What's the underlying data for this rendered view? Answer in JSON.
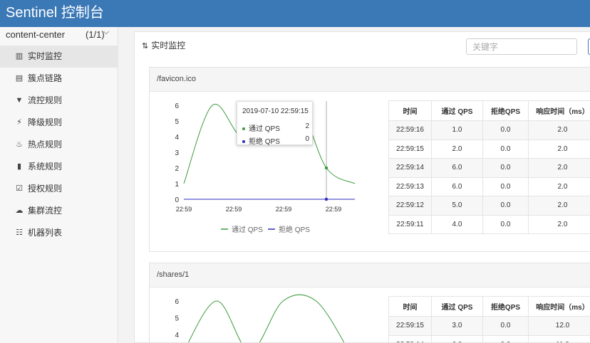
{
  "app": {
    "brand": "Sentinel 控制台"
  },
  "sidebar": {
    "app_name": "content-center",
    "app_count": "(1/1)",
    "items": [
      {
        "label": "实时监控",
        "icon": "bar-chart-icon",
        "active": true
      },
      {
        "label": "簇点链路",
        "icon": "list-icon"
      },
      {
        "label": "流控规则",
        "icon": "filter-icon"
      },
      {
        "label": "降级规则",
        "icon": "bolt-icon"
      },
      {
        "label": "热点规则",
        "icon": "fire-icon"
      },
      {
        "label": "系统规则",
        "icon": "lock-icon"
      },
      {
        "label": "授权规则",
        "icon": "check-icon"
      },
      {
        "label": "集群流控",
        "icon": "cloud-icon"
      },
      {
        "label": "机器列表",
        "icon": "server-list-icon"
      }
    ]
  },
  "main": {
    "title": "实时监控",
    "search_placeholder": "关键字"
  },
  "table_headers": [
    "时间",
    "通过 QPS",
    "拒绝QPS",
    "响应时间（ms）"
  ],
  "panels": [
    {
      "resource": "/favicon.ico",
      "tooltip": {
        "time": "2019-07-10 22:59:15",
        "pass_label": "通过 QPS",
        "pass_value": "2",
        "block_label": "拒绝 QPS",
        "block_value": "0"
      },
      "rows": [
        [
          "22:59:16",
          "1.0",
          "0.0",
          "2.0"
        ],
        [
          "22:59:15",
          "2.0",
          "0.0",
          "2.0"
        ],
        [
          "22:59:14",
          "6.0",
          "0.0",
          "2.0"
        ],
        [
          "22:59:13",
          "6.0",
          "0.0",
          "2.0"
        ],
        [
          "22:59:12",
          "5.0",
          "0.0",
          "2.0"
        ],
        [
          "22:59:11",
          "4.0",
          "0.0",
          "2.0"
        ]
      ]
    },
    {
      "resource": "/shares/1",
      "rows": [
        [
          "22:59:15",
          "3.0",
          "0.0",
          "12.0"
        ],
        [
          "22:59:14",
          "6.0",
          "0.0",
          "11.0"
        ]
      ]
    }
  ],
  "chart_data": [
    {
      "type": "line",
      "x": [
        0,
        1,
        2,
        3,
        4,
        5,
        6
      ],
      "xtick_labels": [
        "22:59",
        "22:59",
        "22:59",
        "22:59"
      ],
      "yticks": [
        0,
        1,
        2,
        3,
        4,
        5,
        6
      ],
      "ylim": [
        0,
        6
      ],
      "legend": "bottom",
      "series": [
        {
          "name": "通过 QPS",
          "color": "#3d9a3d",
          "values": [
            1,
            6,
            4,
            4,
            6,
            2,
            1
          ]
        },
        {
          "name": "拒绝 QPS",
          "color": "#2c2cbf",
          "values": [
            0,
            0,
            0,
            0,
            0,
            0,
            0
          ]
        }
      ]
    },
    {
      "type": "line",
      "x": [
        0,
        1,
        2,
        3,
        4,
        5
      ],
      "yticks": [
        4,
        5,
        6
      ],
      "ylim": [
        0,
        6
      ],
      "series": [
        {
          "name": "通过 QPS",
          "color": "#3d9a3d",
          "values": [
            3,
            6,
            3,
            6,
            6,
            3
          ]
        },
        {
          "name": "拒绝 QPS",
          "color": "#2c2cbf",
          "values": [
            0,
            0,
            0,
            0,
            0,
            0
          ]
        }
      ]
    }
  ]
}
